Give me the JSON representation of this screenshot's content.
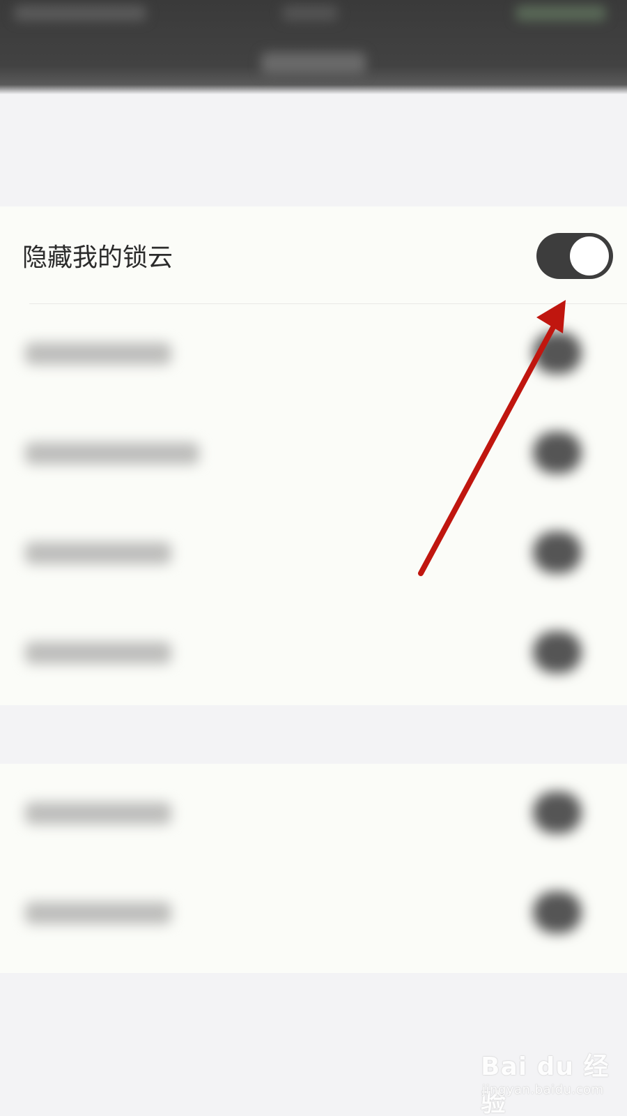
{
  "settings": {
    "hide_lock_cloud": {
      "label": "隐藏我的锁云",
      "enabled": true
    }
  },
  "annotation": {
    "arrow_color": "#c0160f"
  },
  "theme": {
    "toggle_on_color": "#3d3d3d",
    "row_background": "#fbfcf8",
    "page_background": "#f3f3f5"
  },
  "watermark": {
    "brand": "Bai du 经验",
    "url": "jingyan.baidu.com"
  }
}
